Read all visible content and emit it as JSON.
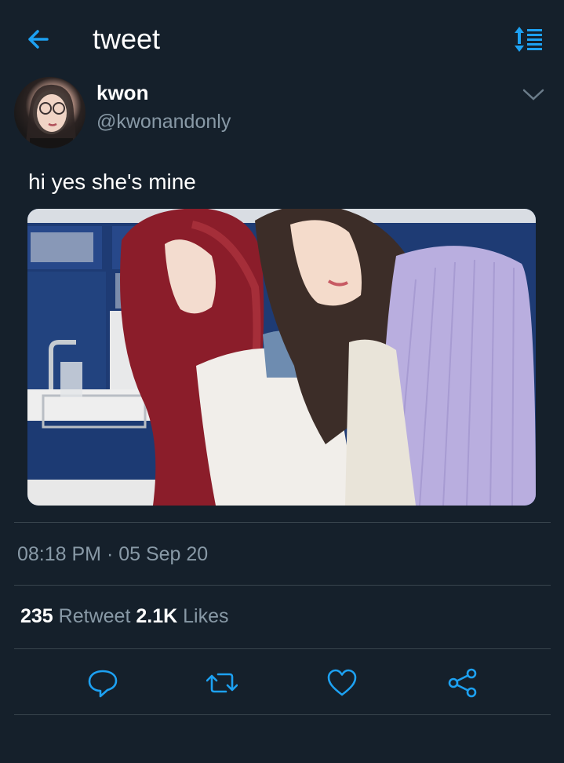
{
  "header": {
    "title": "tweet",
    "back_icon": "arrow-left-icon",
    "sort_icon": "sort-list-icon",
    "accent_color": "#1da1f2"
  },
  "tweet": {
    "display_name": "kwon",
    "handle": "@kwonandonly",
    "text": "hi yes she's mine",
    "timestamp": "08:18 PM · 05 Sep 20",
    "retweet_count": "235",
    "retweet_label": "Retweet",
    "like_count": "2.1K",
    "like_label": "Likes"
  },
  "actions": [
    "reply-icon",
    "retweet-icon",
    "like-icon",
    "share-icon"
  ],
  "colors": {
    "background": "#15202b",
    "secondary_text": "#8899a6",
    "divider": "#38444d"
  }
}
